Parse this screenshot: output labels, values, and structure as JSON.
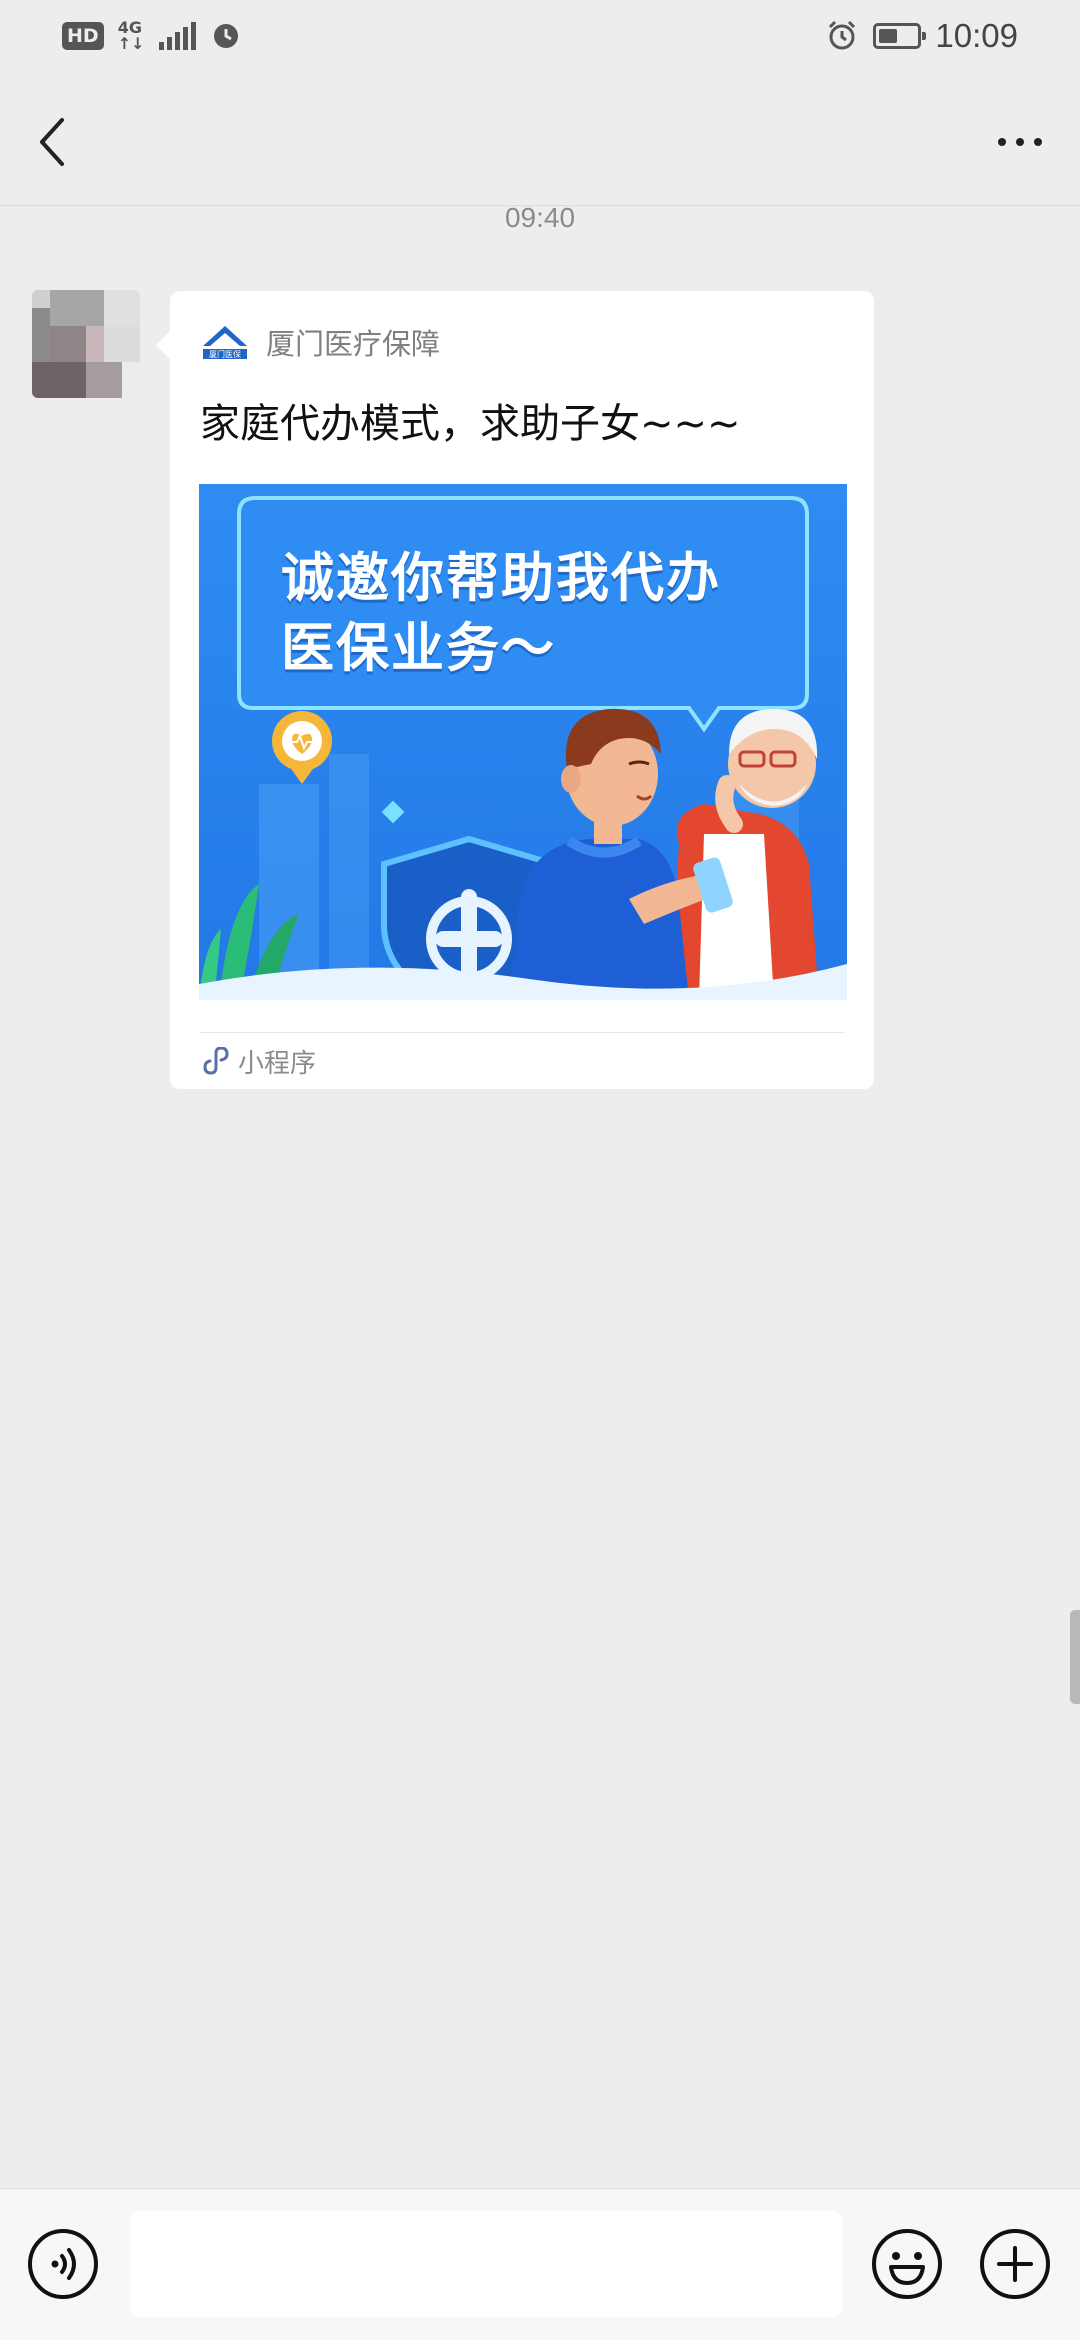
{
  "status_bar": {
    "hd": "HD",
    "network": "4G",
    "net_sub": "↑↓",
    "time": "10:09",
    "battery_level": 0.5
  },
  "nav": {
    "back_icon": "chevron-left-icon",
    "more_icon": "more-horizontal-icon"
  },
  "chat": {
    "timestamp": "09:40",
    "message": {
      "source_name": "厦门医疗保障",
      "logo_text": "厦门医保",
      "title": "家庭代办模式，求助子女~~~",
      "image_text_line1": "诚邀你帮助我代办",
      "image_text_line2": "医保业务～",
      "footer_label": "小程序"
    }
  },
  "input_bar": {
    "voice_icon": "voice-icon",
    "emoji_icon": "emoji-icon",
    "plus_icon": "plus-circle-icon",
    "placeholder": ""
  },
  "colors": {
    "background": "#ededed",
    "card": "#ffffff",
    "image_blue": "#2f8cf2",
    "shirt_blue": "#1f5fd6",
    "shield_blue": "#1a5fc8"
  }
}
